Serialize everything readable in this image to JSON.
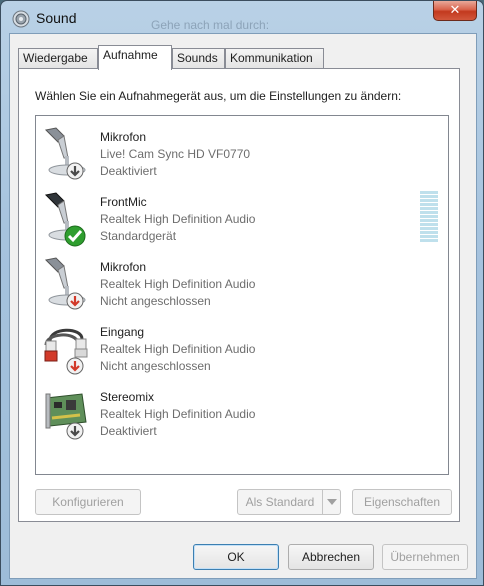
{
  "window": {
    "title": "Sound",
    "background_text": "Gehe nach mal durch:",
    "close_label": "✕"
  },
  "tabs": [
    {
      "label": "Wiedergabe",
      "active": false
    },
    {
      "label": "Aufnahme",
      "active": true
    },
    {
      "label": "Sounds",
      "active": false
    },
    {
      "label": "Kommunikation",
      "active": false
    }
  ],
  "panel": {
    "instruction": "Wählen Sie ein Aufnahmegerät aus, um die Einstellungen zu ändern:"
  },
  "devices": [
    {
      "name": "Mikrofon",
      "description": "Live! Cam Sync HD VF0770",
      "status": "Deaktiviert",
      "icon": "microphone-icon",
      "badge": "disabled-badge-icon"
    },
    {
      "name": "FrontMic",
      "description": "Realtek High Definition Audio",
      "status": "Standardgerät",
      "icon": "microphone-icon",
      "badge": "default-check-badge-icon"
    },
    {
      "name": "Mikrofon",
      "description": "Realtek High Definition Audio",
      "status": "Nicht angeschlossen",
      "icon": "microphone-icon",
      "badge": "unplugged-badge-icon"
    },
    {
      "name": "Eingang",
      "description": "Realtek High Definition Audio",
      "status": "Nicht angeschlossen",
      "icon": "line-in-cable-icon",
      "badge": "unplugged-badge-icon"
    },
    {
      "name": "Stereomix",
      "description": "Realtek High Definition Audio",
      "status": "Deaktiviert",
      "icon": "sound-card-icon",
      "badge": "disabled-badge-icon"
    }
  ],
  "buttons": {
    "configure": "Konfigurieren",
    "set_default": "Als Standard",
    "properties": "Eigenschaften",
    "ok": "OK",
    "cancel": "Abbrechen",
    "apply": "Übernehmen"
  },
  "colors": {
    "accent": "#3c7fb1",
    "default_check": "#2f9e2f",
    "unplugged_arrow": "#d23a2a",
    "disabled_arrow": "#4a4a4a",
    "level_meter": "#bfe0ec"
  }
}
